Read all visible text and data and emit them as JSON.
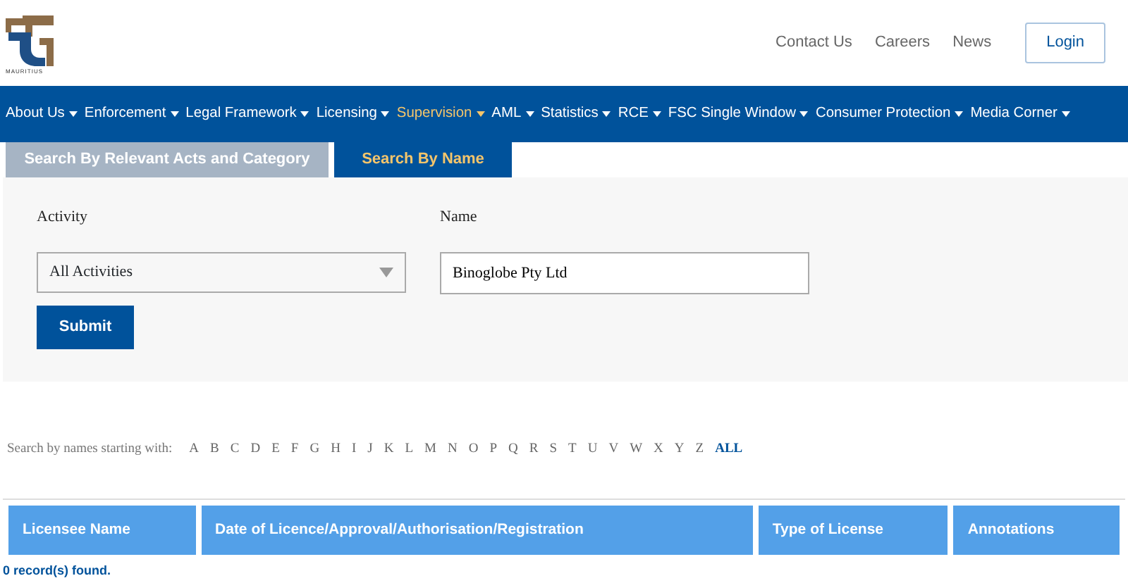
{
  "logo": {
    "caption": "MAURITIUS"
  },
  "top_links": [
    "Contact Us",
    "Careers",
    "News"
  ],
  "login_button": "Login",
  "nav": [
    {
      "label": "About Us",
      "selected": false
    },
    {
      "label": "Enforcement",
      "selected": false
    },
    {
      "label": "Legal Framework",
      "selected": false
    },
    {
      "label": "Licensing",
      "selected": false
    },
    {
      "label": "Supervision",
      "selected": true
    },
    {
      "label": "AML",
      "selected": false
    },
    {
      "label": "Statistics",
      "selected": false
    },
    {
      "label": "RCE",
      "selected": false
    },
    {
      "label": "FSC Single Window",
      "selected": false
    },
    {
      "label": "Consumer Protection",
      "selected": false
    },
    {
      "label": "Media Corner",
      "selected": false
    }
  ],
  "tabs": [
    {
      "label": "Search By Relevant Acts and Category",
      "selected": false
    },
    {
      "label": "Search By Name",
      "selected": true
    }
  ],
  "form": {
    "activity_label": "Activity",
    "activity_value": "All Activities",
    "name_label": "Name",
    "name_value": "Binoglobe Pty Ltd",
    "submit": "Submit"
  },
  "letter_filter": {
    "label": "Search by names starting with:",
    "letters": [
      {
        "label": "A",
        "selected": false
      },
      {
        "label": "B",
        "selected": false
      },
      {
        "label": "C",
        "selected": false
      },
      {
        "label": "D",
        "selected": false
      },
      {
        "label": "E",
        "selected": false
      },
      {
        "label": "F",
        "selected": false
      },
      {
        "label": "G",
        "selected": false
      },
      {
        "label": "H",
        "selected": false
      },
      {
        "label": "I",
        "selected": false
      },
      {
        "label": "J",
        "selected": false
      },
      {
        "label": "K",
        "selected": false
      },
      {
        "label": "L",
        "selected": false
      },
      {
        "label": "M",
        "selected": false
      },
      {
        "label": "N",
        "selected": false
      },
      {
        "label": "O",
        "selected": false
      },
      {
        "label": "P",
        "selected": false
      },
      {
        "label": "Q",
        "selected": false
      },
      {
        "label": "R",
        "selected": false
      },
      {
        "label": "S",
        "selected": false
      },
      {
        "label": "T",
        "selected": false
      },
      {
        "label": "U",
        "selected": false
      },
      {
        "label": "V",
        "selected": false
      },
      {
        "label": "W",
        "selected": false
      },
      {
        "label": "X",
        "selected": false
      },
      {
        "label": "Y",
        "selected": false
      },
      {
        "label": "Z",
        "selected": false
      },
      {
        "label": "ALL",
        "selected": true
      }
    ]
  },
  "table": {
    "columns": [
      "Licensee Name",
      "Date of Licence/Approval/Authorisation/Registration",
      "Type of License",
      "Annotations"
    ]
  },
  "status": "0 record(s) found."
}
